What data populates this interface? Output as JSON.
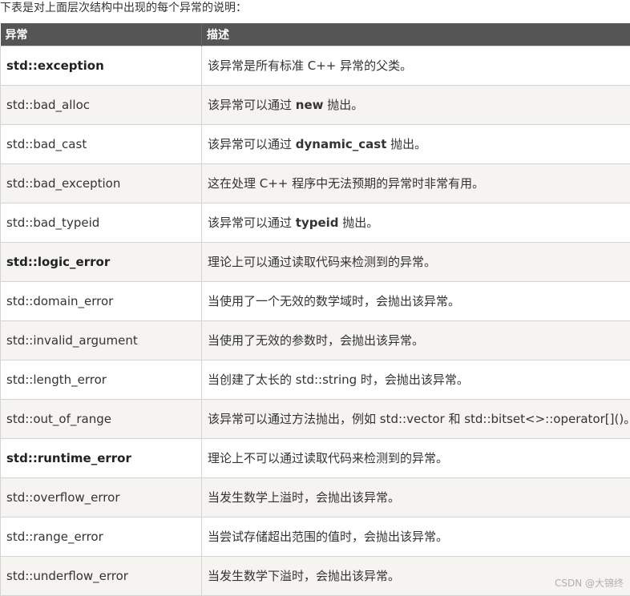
{
  "intro": "下表是对上面层次结构中出现的每个异常的说明：",
  "table": {
    "headers": [
      "异常",
      "描述"
    ],
    "rows": [
      {
        "name": "std::exception",
        "bold": true,
        "desc": [
          "该异常是所有标准 C++ 异常的父类。"
        ]
      },
      {
        "name": "std::bad_alloc",
        "bold": false,
        "desc": [
          "该异常可以通过 ",
          "new",
          " 抛出。"
        ]
      },
      {
        "name": "std::bad_cast",
        "bold": false,
        "desc": [
          "该异常可以通过 ",
          "dynamic_cast",
          " 抛出。"
        ]
      },
      {
        "name": "std::bad_exception",
        "bold": false,
        "desc": [
          "这在处理 C++ 程序中无法预期的异常时非常有用。"
        ]
      },
      {
        "name": "std::bad_typeid",
        "bold": false,
        "desc": [
          "该异常可以通过 ",
          "typeid",
          " 抛出。"
        ]
      },
      {
        "name": "std::logic_error",
        "bold": true,
        "desc": [
          "理论上可以通过读取代码来检测到的异常。"
        ]
      },
      {
        "name": "std::domain_error",
        "bold": false,
        "desc": [
          "当使用了一个无效的数学域时，会抛出该异常。"
        ]
      },
      {
        "name": "std::invalid_argument",
        "bold": false,
        "desc": [
          "当使用了无效的参数时，会抛出该异常。"
        ]
      },
      {
        "name": "std::length_error",
        "bold": false,
        "desc": [
          "当创建了太长的 std::string 时，会抛出该异常。"
        ]
      },
      {
        "name": "std::out_of_range",
        "bold": false,
        "desc": [
          "该异常可以通过方法抛出，例如 std::vector 和 std::bitset<>::operator[]()。"
        ]
      },
      {
        "name": "std::runtime_error",
        "bold": true,
        "desc": [
          "理论上不可以通过读取代码来检测到的异常。"
        ]
      },
      {
        "name": "std::overflow_error",
        "bold": false,
        "desc": [
          "当发生数学上溢时，会抛出该异常。"
        ]
      },
      {
        "name": "std::range_error",
        "bold": false,
        "desc": [
          "当尝试存储超出范围的值时，会抛出该异常。"
        ]
      },
      {
        "name": "std::underflow_error",
        "bold": false,
        "desc": [
          "当发生数学下溢时，会抛出该异常。"
        ]
      }
    ]
  },
  "watermark": "CSDN @大锦终"
}
